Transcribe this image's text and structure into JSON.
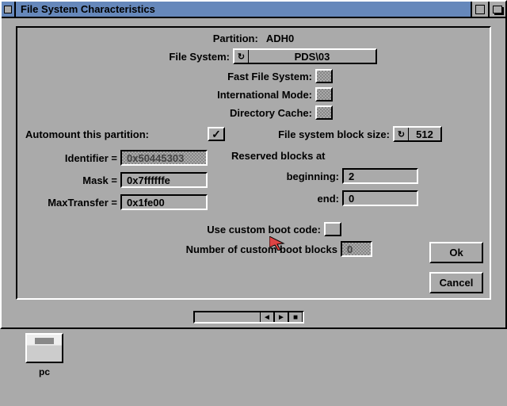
{
  "window": {
    "title": "File System Characteristics"
  },
  "partition": {
    "label": "Partition:",
    "value": "ADH0"
  },
  "filesystem": {
    "label": "File System:",
    "value": "PDS\\03"
  },
  "flags": {
    "ffs_label": "Fast File System:",
    "intl_label": "International Mode:",
    "dircache_label": "Directory Cache:"
  },
  "automount": {
    "label": "Automount this partition:",
    "checked": true
  },
  "blocksize": {
    "label": "File system block size:",
    "value": "512"
  },
  "identifier": {
    "label": "Identifier =",
    "value": "0x50445303"
  },
  "mask": {
    "label": "Mask =",
    "value": "0x7ffffffe"
  },
  "maxtransfer": {
    "label": "MaxTransfer =",
    "value": "0x1fe00"
  },
  "reserved": {
    "header": "Reserved blocks at",
    "begin_label": "beginning:",
    "begin_value": "2",
    "end_label": "end:",
    "end_value": "0"
  },
  "customboot": {
    "label": "Use custom boot code:"
  },
  "bootblocks": {
    "label": "Number of custom boot blocks",
    "value": "0"
  },
  "buttons": {
    "ok": "Ok",
    "cancel": "Cancel"
  },
  "desktop": {
    "disk_label": "pc"
  }
}
